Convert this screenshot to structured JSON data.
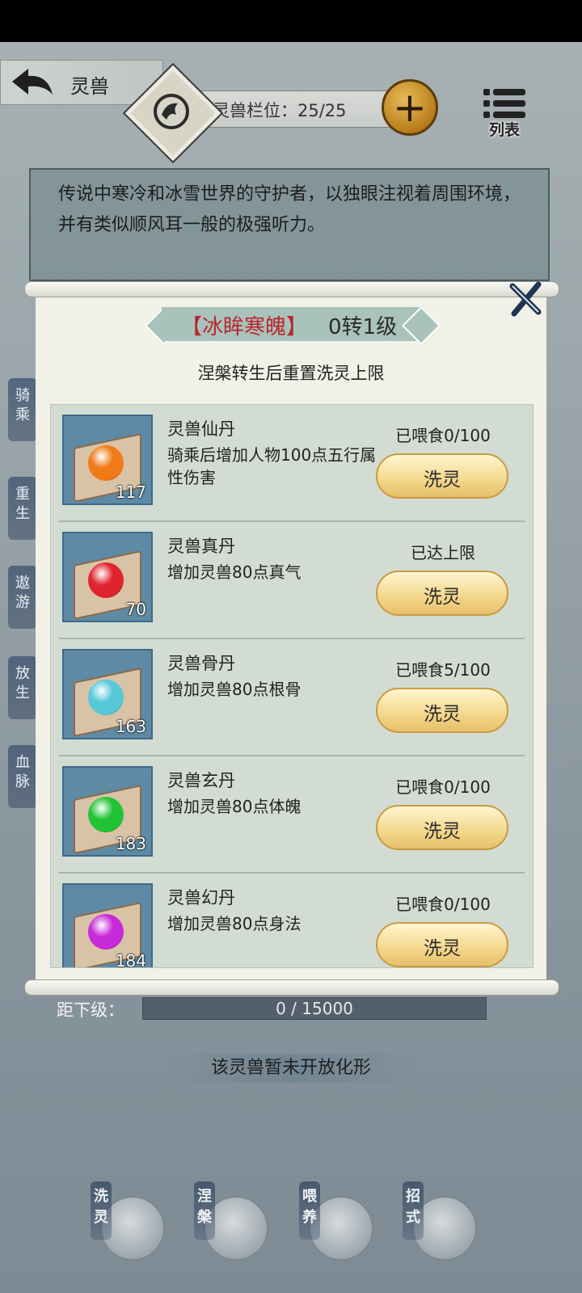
{
  "header": {
    "title": "灵兽",
    "slot_label": "灵兽栏位：25/25",
    "list_label": "列表"
  },
  "description": "传说中寒冷和冰雪世界的守护者，以独眼注视着周围环境，并有类似顺风耳一般的极强听力。",
  "side_tabs": [
    "骑乘",
    "重生",
    "遨游",
    "放生",
    "血脉"
  ],
  "dialog": {
    "name": "【冰眸寒魄】",
    "level": "0转1级",
    "hint": "涅槃转生后重置洗灵上限",
    "items": [
      {
        "name": "灵兽仙丹",
        "desc": "骑乘后增加人物100点五行属性伤害",
        "status": "已喂食0/100",
        "count": "117",
        "button": "洗灵",
        "orb_color": "#f07a18"
      },
      {
        "name": "灵兽真丹",
        "desc": "增加灵兽80点真气",
        "status": "已达上限",
        "count": "70",
        "button": "洗灵",
        "orb_color": "#e0242e"
      },
      {
        "name": "灵兽骨丹",
        "desc": "增加灵兽80点根骨",
        "status": "已喂食5/100",
        "count": "163",
        "button": "洗灵",
        "orb_color": "#56c8d8"
      },
      {
        "name": "灵兽玄丹",
        "desc": "增加灵兽80点体魄",
        "status": "已喂食0/100",
        "count": "183",
        "button": "洗灵",
        "orb_color": "#22c436"
      },
      {
        "name": "灵兽幻丹",
        "desc": "增加灵兽80点身法",
        "status": "已喂食0/100",
        "count": "184",
        "button": "洗灵",
        "orb_color": "#c72ad8"
      }
    ]
  },
  "bottom": {
    "next_level_label": "距下级：",
    "progress_text": "0 / 15000",
    "progress_fraction": 0,
    "notice": "该灵兽暂未开放化形",
    "actions": [
      "洗灵",
      "涅槃",
      "喂养",
      "招式"
    ]
  }
}
